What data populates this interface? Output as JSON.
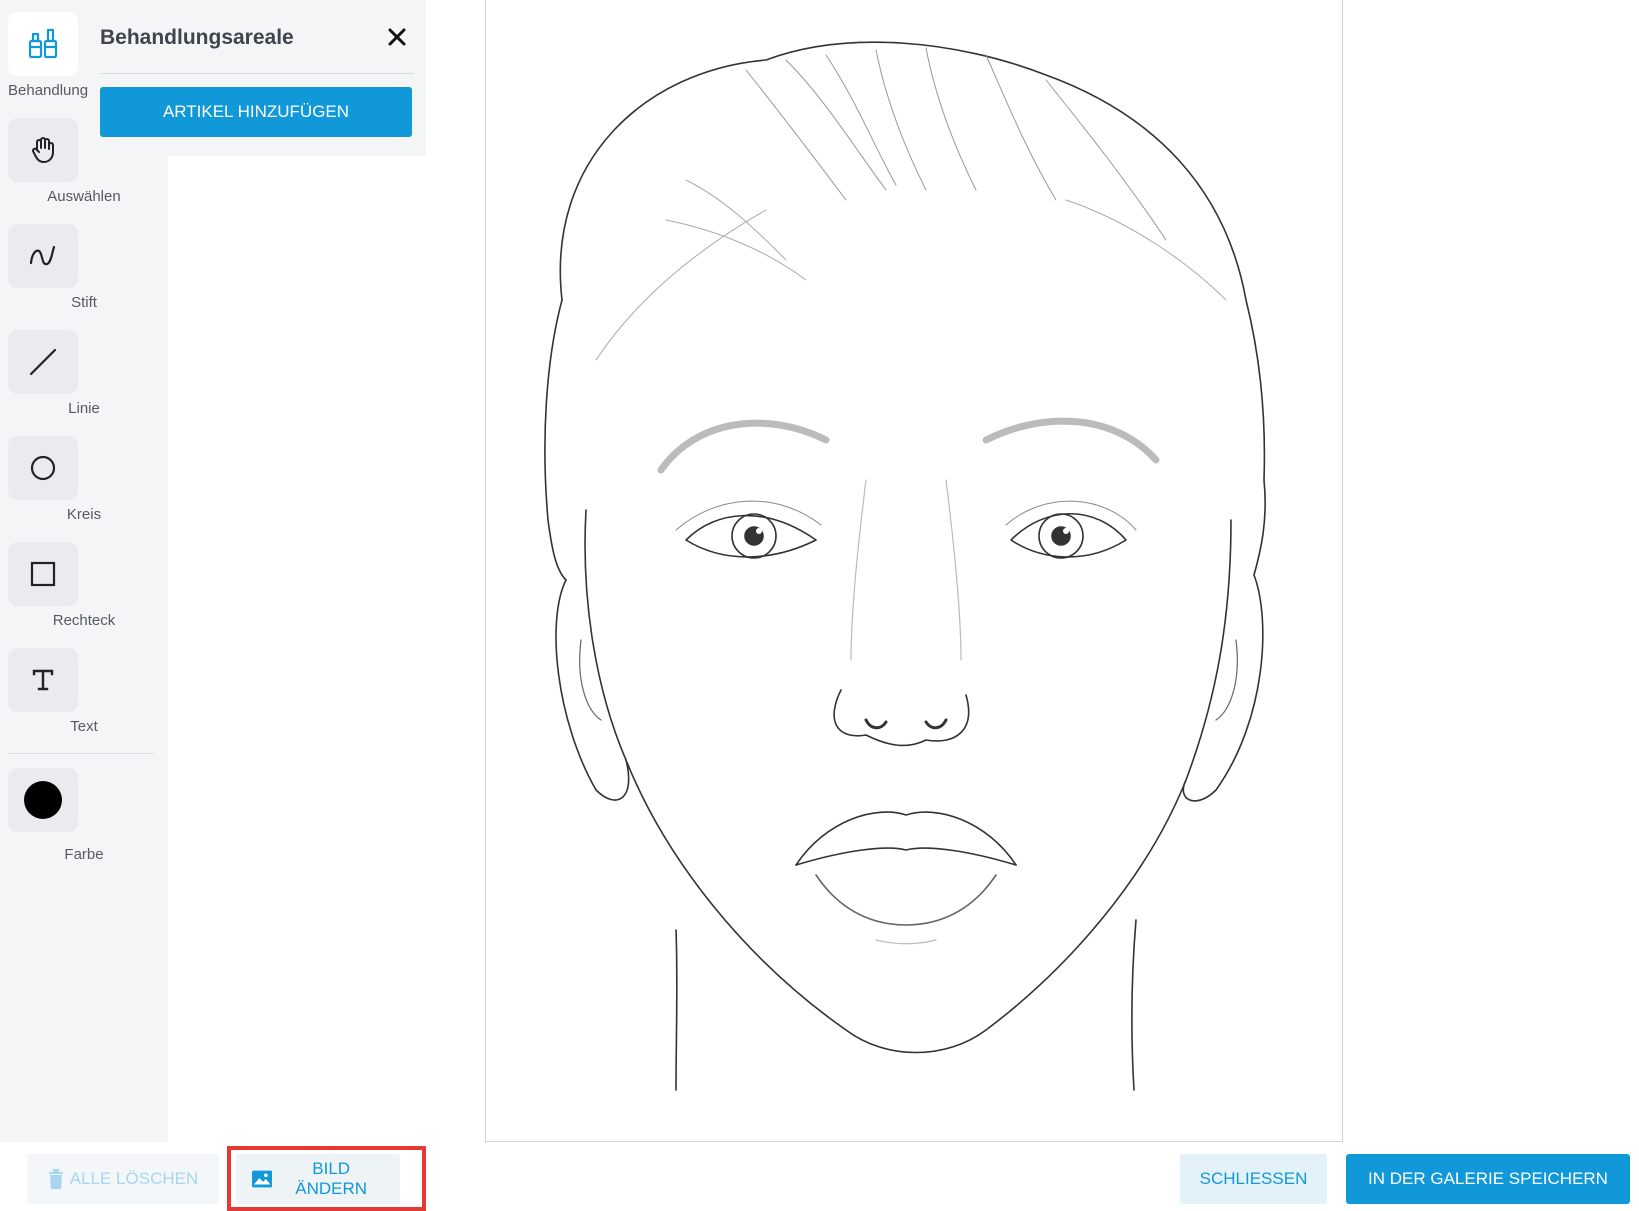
{
  "toolbar": {
    "tools": [
      {
        "label": "Behandlungsareale",
        "icon": "bottles-icon"
      },
      {
        "label": "Auswählen",
        "icon": "hand-icon"
      },
      {
        "label": "Stift",
        "icon": "pen-curve-icon"
      },
      {
        "label": "Linie",
        "icon": "line-icon"
      },
      {
        "label": "Kreis",
        "icon": "circle-icon"
      },
      {
        "label": "Rechteck",
        "icon": "rectangle-icon"
      },
      {
        "label": "Text",
        "icon": "text-icon"
      }
    ],
    "color": {
      "label": "Farbe",
      "value": "#000000"
    }
  },
  "panel": {
    "title": "Behandlungsareale",
    "add_button": "ARTIKEL HINZUFÜGEN"
  },
  "footer": {
    "clear_all": "ALLE LÖSCHEN",
    "change_image": "BILD ÄNDERN",
    "close": "SCHLIESSEN",
    "save_gallery": "IN DER GALERIE SPEICHERN"
  },
  "colors": {
    "accent": "#1098d8",
    "highlight": "#e53935"
  }
}
